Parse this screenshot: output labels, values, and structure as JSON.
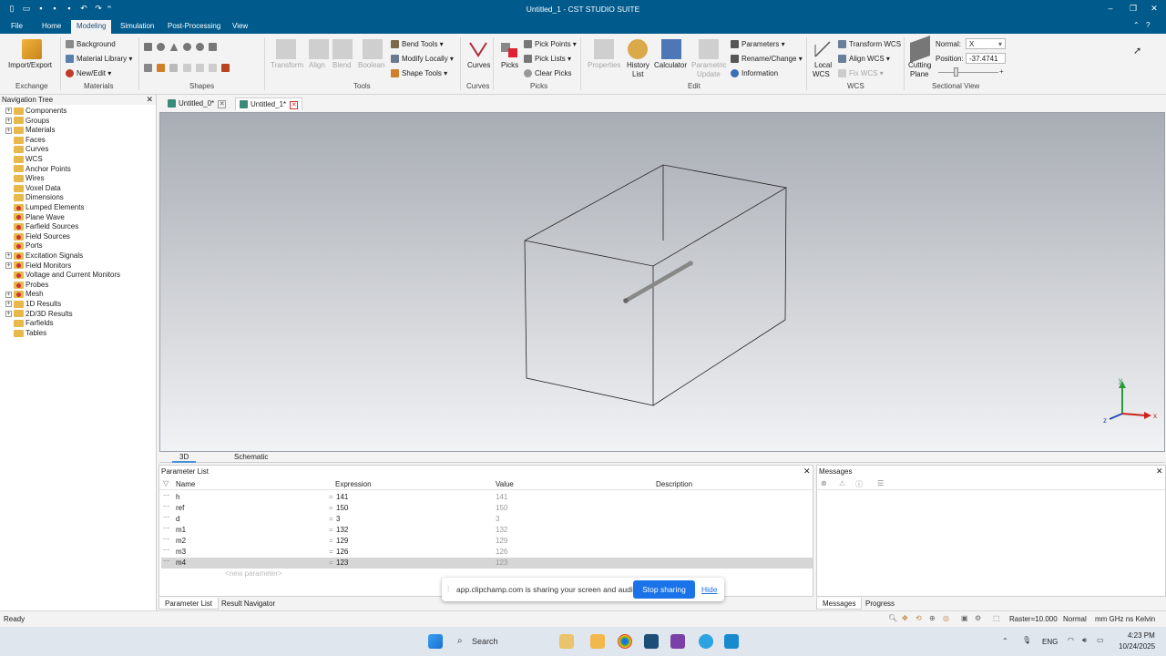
{
  "window": {
    "title": "Untitled_1 - CST STUDIO SUITE"
  },
  "menu": [
    "File",
    "Home",
    "Modeling",
    "Simulation",
    "Post-Processing",
    "View"
  ],
  "ribbon": {
    "exchange": {
      "import_export": "Import/Export",
      "label": "Exchange"
    },
    "materials": {
      "background": "Background",
      "material_library": "Material Library",
      "new_edit": "New/Edit",
      "label": "Materials"
    },
    "shapes": {
      "label": "Shapes"
    },
    "tools": {
      "transform": "Transform",
      "align": "Align",
      "blend": "Blend",
      "boolean": "Boolean",
      "bend_tools": "Bend Tools",
      "modify_locally": "Modify Locally",
      "shape_tools": "Shape Tools",
      "label": "Tools"
    },
    "curves": {
      "curves": "Curves",
      "label": "Curves"
    },
    "picks": {
      "picks": "Picks",
      "pick_points": "Pick Points",
      "pick_lists": "Pick Lists",
      "clear_picks": "Clear Picks",
      "label": "Picks"
    },
    "edit": {
      "properties": "Properties",
      "history": "History",
      "list": "List",
      "calculator": "Calculator",
      "parametric": "Parametric",
      "update": "Update",
      "parameters": "Parameters",
      "rename_change": "Rename/Change",
      "information": "Information",
      "label": "Edit"
    },
    "wcs": {
      "local": "Local",
      "wcs": "WCS",
      "transform_wcs": "Transform WCS",
      "align_wcs": "Align WCS",
      "fix_wcs": "Fix WCS",
      "label": "WCS"
    },
    "sectional": {
      "cutting": "Cutting",
      "plane": "Plane",
      "normal_label": "Normal:",
      "normal_value": "X",
      "position_label": "Position:",
      "position_value": "-37.4741",
      "label": "Sectional View"
    }
  },
  "nav": {
    "title": "Navigation Tree",
    "items": [
      {
        "label": "Components",
        "expand": true,
        "red": false
      },
      {
        "label": "Groups",
        "expand": true,
        "red": false
      },
      {
        "label": "Materials",
        "expand": true,
        "red": false
      },
      {
        "label": "Faces",
        "expand": false,
        "red": false
      },
      {
        "label": "Curves",
        "expand": false,
        "red": false
      },
      {
        "label": "WCS",
        "expand": false,
        "red": false
      },
      {
        "label": "Anchor Points",
        "expand": false,
        "red": false
      },
      {
        "label": "Wires",
        "expand": false,
        "red": false
      },
      {
        "label": "Voxel Data",
        "expand": false,
        "red": false
      },
      {
        "label": "Dimensions",
        "expand": false,
        "red": false
      },
      {
        "label": "Lumped Elements",
        "expand": false,
        "red": true
      },
      {
        "label": "Plane Wave",
        "expand": false,
        "red": true
      },
      {
        "label": "Farfield Sources",
        "expand": false,
        "red": true
      },
      {
        "label": "Field Sources",
        "expand": false,
        "red": true
      },
      {
        "label": "Ports",
        "expand": false,
        "red": true
      },
      {
        "label": "Excitation Signals",
        "expand": true,
        "red": true
      },
      {
        "label": "Field Monitors",
        "expand": true,
        "red": true
      },
      {
        "label": "Voltage and Current Monitors",
        "expand": false,
        "red": true
      },
      {
        "label": "Probes",
        "expand": false,
        "red": true
      },
      {
        "label": "Mesh",
        "expand": true,
        "red": true
      },
      {
        "label": "1D Results",
        "expand": true,
        "red": false
      },
      {
        "label": "2D/3D Results",
        "expand": true,
        "red": false
      },
      {
        "label": "Farfields",
        "expand": false,
        "red": false
      },
      {
        "label": "Tables",
        "expand": false,
        "red": false
      }
    ]
  },
  "doc_tabs": [
    "Untitled_0*",
    "Untitled_1*"
  ],
  "view_tabs": [
    "3D",
    "Schematic"
  ],
  "parameter_list": {
    "title": "Parameter List",
    "columns": [
      "Name",
      "Expression",
      "Value",
      "Description"
    ],
    "rows": [
      {
        "name": "h",
        "expr": "141",
        "value": "141"
      },
      {
        "name": "ref",
        "expr": "150",
        "value": "150"
      },
      {
        "name": "d",
        "expr": "3",
        "value": "3"
      },
      {
        "name": "m1",
        "expr": "132",
        "value": "132"
      },
      {
        "name": "m2",
        "expr": "129",
        "value": "129"
      },
      {
        "name": "m3",
        "expr": "126",
        "value": "126"
      },
      {
        "name": "m4",
        "expr": "123",
        "value": "123"
      }
    ],
    "new_param": "<new parameter>",
    "eq": "="
  },
  "messages": {
    "title": "Messages"
  },
  "bottom_tabs": [
    "Parameter List",
    "Result Navigator",
    "Messages",
    "Progress"
  ],
  "share": {
    "text": "app.clipchamp.com is sharing your screen and audio.",
    "stop": "Stop sharing",
    "hide": "Hide"
  },
  "status": {
    "ready": "Ready",
    "raster": "Raster=10.000",
    "mode": "Normal",
    "units": "mm  GHz  ns  Kelvin"
  },
  "taskbar": {
    "search": "Search",
    "lang": "ENG",
    "time": "4:23 PM",
    "date": "10/24/2025"
  },
  "axes": {
    "x": "x",
    "y": "y",
    "z": "z"
  }
}
